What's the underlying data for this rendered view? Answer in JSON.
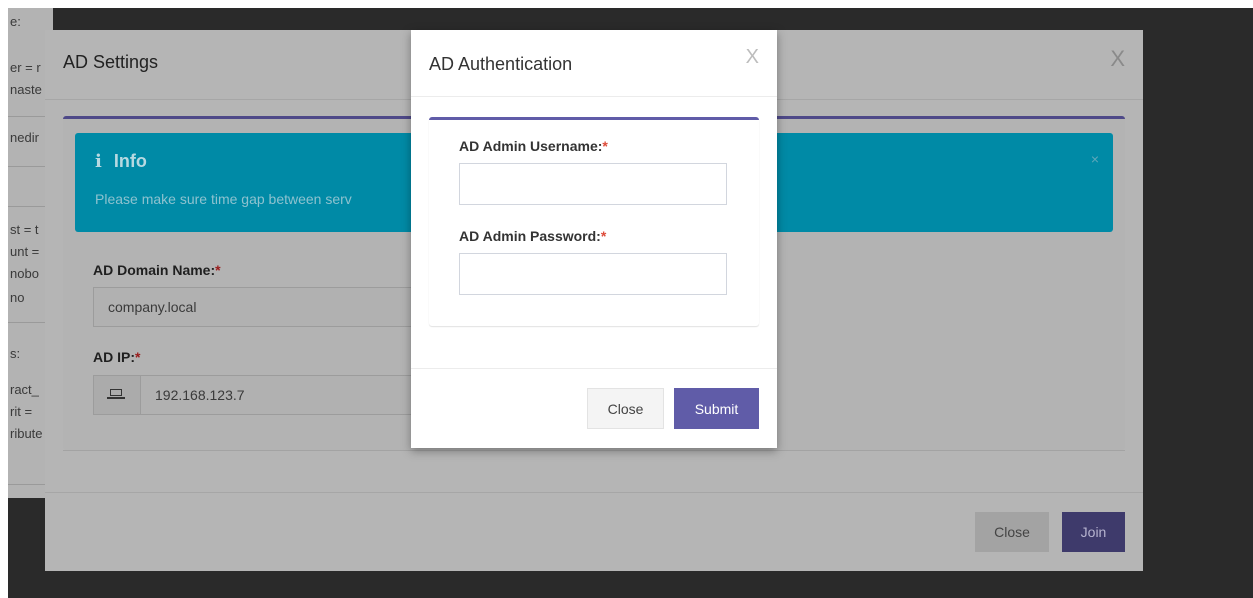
{
  "background_fragments": [
    "e:",
    "er = r",
    "naste",
    "nedir",
    "st = t",
    "unt =",
    "nobo",
    "no",
    "s:",
    "ract_",
    "rit =",
    "ribute"
  ],
  "outer_dialog": {
    "title": "AD Settings",
    "close_glyph": "X",
    "info": {
      "icon": "i",
      "title": "Info",
      "text": "Please make sure time gap between serv",
      "dismiss_glyph": "×"
    },
    "domain": {
      "label": "AD Domain Name:",
      "required_mark": "*",
      "value": "company.local"
    },
    "ip": {
      "label": "AD IP:",
      "required_mark": "*",
      "value": "192.168.123.7"
    },
    "buttons": {
      "close": "Close",
      "join": "Join"
    }
  },
  "inner_dialog": {
    "title": "AD Authentication",
    "close_glyph": "X",
    "username": {
      "label": "AD Admin Username:",
      "required_mark": "*",
      "value": ""
    },
    "password": {
      "label": "AD Admin Password:",
      "required_mark": "*",
      "value": ""
    },
    "buttons": {
      "close": "Close",
      "submit": "Submit"
    }
  },
  "colors": {
    "accent_purple": "#605ca8",
    "info_blue": "#00c0ef",
    "required_red": "#dd4b39"
  }
}
